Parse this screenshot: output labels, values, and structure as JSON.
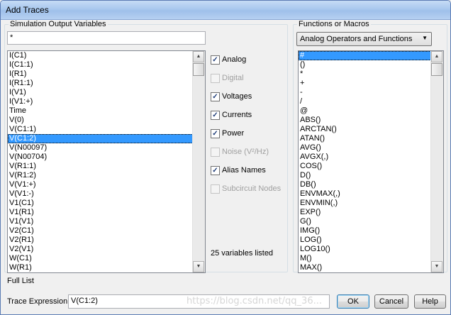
{
  "window": {
    "title": "Add Traces"
  },
  "left_group": {
    "label": "Simulation Output Variables",
    "filter_value": "*",
    "variables": [
      "I(C1)",
      "I(C1:1)",
      "I(R1)",
      "I(R1:1)",
      "I(V1)",
      "I(V1:+)",
      "Time",
      "V(0)",
      "V(C1:1)",
      "V(C1:2)",
      "V(N00097)",
      "V(N00704)",
      "V(R1:1)",
      "V(R1:2)",
      "V(V1:+)",
      "V(V1:-)",
      "V1(C1)",
      "V1(R1)",
      "V1(V1)",
      "V2(C1)",
      "V2(R1)",
      "V2(V1)",
      "W(C1)",
      "W(R1)"
    ],
    "selected_index": 9
  },
  "filters": [
    {
      "label": "Analog",
      "checked": true,
      "enabled": true
    },
    {
      "label": "Digital",
      "checked": false,
      "enabled": false
    },
    {
      "label": "Voltages",
      "checked": true,
      "enabled": true
    },
    {
      "label": "Currents",
      "checked": true,
      "enabled": true
    },
    {
      "label": "Power",
      "checked": true,
      "enabled": true
    },
    {
      "label": "Noise (V²/Hz)",
      "checked": false,
      "enabled": false
    },
    {
      "label": "Alias Names",
      "checked": true,
      "enabled": true
    },
    {
      "label": "Subcircuit Nodes",
      "checked": false,
      "enabled": false
    }
  ],
  "variables_count": "25 variables listed",
  "right_group": {
    "label": "Functions or Macros",
    "dropdown_value": "Analog Operators and Functions",
    "functions": [
      "#",
      "()",
      "*",
      "+",
      "-",
      "/",
      "@",
      "ABS()",
      "ARCTAN()",
      "ATAN()",
      "AVG()",
      "AVGX(,)",
      "COS()",
      "D()",
      "DB()",
      "ENVMAX(,)",
      "ENVMIN(,)",
      "EXP()",
      "G()",
      "IMG()",
      "LOG()",
      "LOG10()",
      "M()",
      "MAX()"
    ],
    "selected_index": 0
  },
  "full_list_label": "Full List",
  "trace": {
    "label": "Trace Expression:",
    "value": "V(C1:2)"
  },
  "buttons": {
    "ok": "OK",
    "cancel": "Cancel",
    "help": "Help"
  },
  "watermark": "https://blog.csdn.net/qq_36..."
}
